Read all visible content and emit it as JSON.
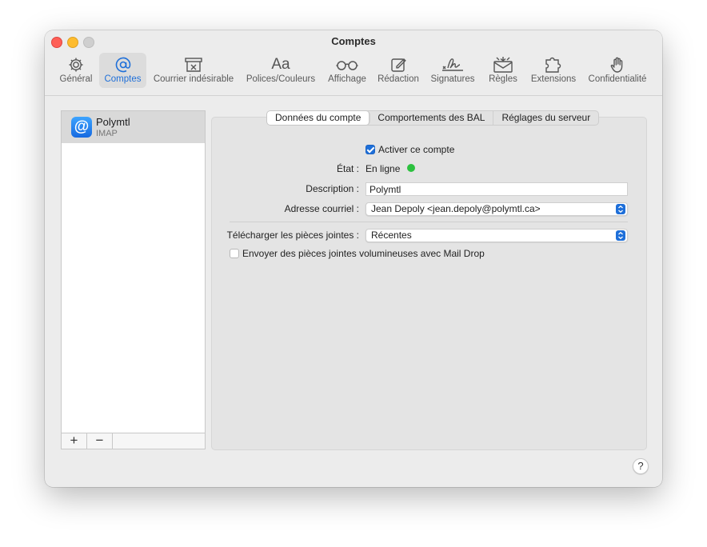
{
  "window": {
    "title": "Comptes"
  },
  "toolbar": {
    "items": [
      {
        "label": "Général",
        "icon": "gear-icon"
      },
      {
        "label": "Comptes",
        "icon": "at-sign-icon",
        "active": true
      },
      {
        "label": "Courrier indésirable",
        "icon": "junk-tray-icon"
      },
      {
        "label": "Polices/Couleurs",
        "icon": "font-icon",
        "glyph": "Aa"
      },
      {
        "label": "Affichage",
        "icon": "glasses-icon"
      },
      {
        "label": "Rédaction",
        "icon": "compose-icon"
      },
      {
        "label": "Signatures",
        "icon": "signature-icon"
      },
      {
        "label": "Règles",
        "icon": "rules-envelope-icon"
      },
      {
        "label": "Extensions",
        "icon": "puzzle-icon"
      },
      {
        "label": "Confidentialité",
        "icon": "hand-icon"
      }
    ]
  },
  "sidebar": {
    "accounts": [
      {
        "name": "Polymtl",
        "type": "IMAP",
        "icon_glyph": "@"
      }
    ],
    "add_label": "+",
    "remove_label": "−"
  },
  "tabs": [
    {
      "label": "Données du compte",
      "active": true
    },
    {
      "label": "Comportements des BAL"
    },
    {
      "label": "Réglages du serveur"
    }
  ],
  "form": {
    "enable_label": "Activer ce compte",
    "enable_checked": true,
    "state_label": "État :",
    "state_value": "En ligne",
    "state_color": "#2cc13f",
    "description_label": "Description :",
    "description_value": "Polymtl",
    "email_label": "Adresse courriel :",
    "email_value": "Jean Depoly <jean.depoly@polymtl.ca>",
    "download_label": "Télécharger les pièces jointes :",
    "download_value": "Récentes",
    "maildrop_label": "Envoyer des pièces jointes volumineuses avec Mail Drop",
    "maildrop_checked": false
  },
  "help": {
    "label": "?"
  },
  "colors": {
    "accent": "#1e6fd9"
  }
}
